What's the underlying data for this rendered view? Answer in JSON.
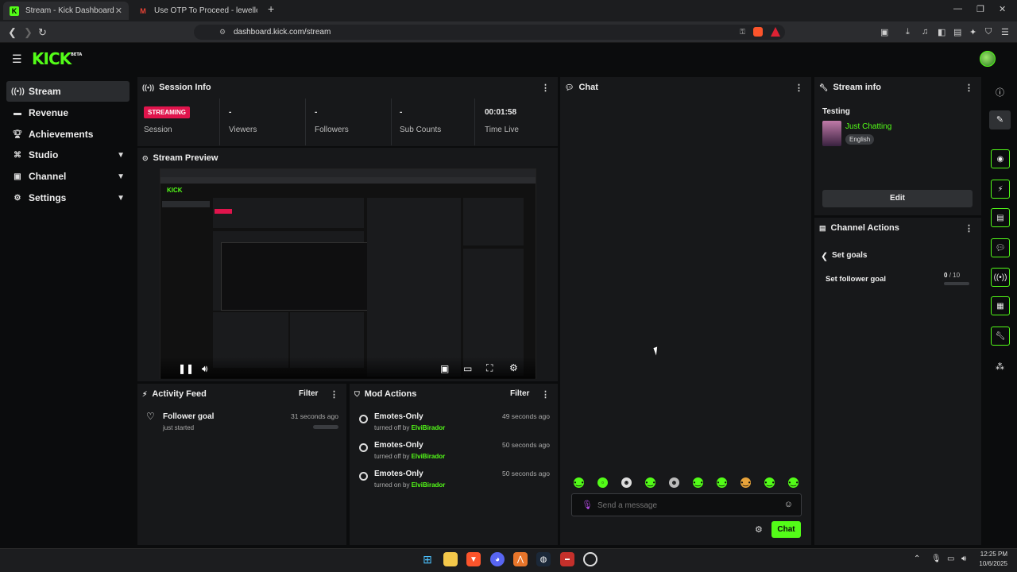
{
  "browser": {
    "tabs": [
      {
        "title": "Stream - Kick Dashboard"
      },
      {
        "title": "Use OTP To Proceed - lewellevillo@g"
      }
    ],
    "url": "dashboard.kick.com/stream"
  },
  "app": {
    "logo": "KICK",
    "logo_badge": "BETA",
    "accent": "#53fc18"
  },
  "sidebar": {
    "items": [
      {
        "label": "Stream",
        "icon": "broadcast-icon"
      },
      {
        "label": "Revenue",
        "icon": "money-icon"
      },
      {
        "label": "Achievements",
        "icon": "trophy-icon"
      },
      {
        "label": "Studio",
        "icon": "studio-icon"
      },
      {
        "label": "Channel",
        "icon": "channel-icon"
      },
      {
        "label": "Settings",
        "icon": "gear-icon"
      }
    ]
  },
  "session": {
    "title": "Session Info",
    "status": "STREAMING",
    "status_label": "Session",
    "stats": [
      {
        "value": "-",
        "label": "Viewers"
      },
      {
        "value": "-",
        "label": "Followers"
      },
      {
        "value": "-",
        "label": "Sub Counts"
      },
      {
        "value": "00:01:58",
        "label": "Time Live"
      }
    ]
  },
  "preview": {
    "title": "Stream Preview"
  },
  "activity": {
    "title": "Activity Feed",
    "filter": "Filter",
    "items": [
      {
        "title": "Follower goal",
        "sub": "just started",
        "time": "31 seconds ago"
      }
    ]
  },
  "mod": {
    "title": "Mod Actions",
    "filter": "Filter",
    "items": [
      {
        "title": "Emotes-Only",
        "action": "turned off by",
        "user": "ElviBirador",
        "time": "49 seconds ago"
      },
      {
        "title": "Emotes-Only",
        "action": "turned off by",
        "user": "ElviBirador",
        "time": "50 seconds ago"
      },
      {
        "title": "Emotes-Only",
        "action": "turned on by",
        "user": "ElviBirador",
        "time": "50 seconds ago"
      }
    ]
  },
  "chat": {
    "title": "Chat",
    "placeholder": "Send a message",
    "send": "Chat"
  },
  "stream_info": {
    "title": "Stream info",
    "stream_title": "Testing",
    "category": "Just Chatting",
    "language": "English",
    "edit": "Edit"
  },
  "channel_actions": {
    "title": "Channel Actions",
    "back": "Set goals",
    "goal_label": "Set follower goal",
    "goal_current": "0",
    "goal_total": "/ 10",
    "goal_progress": 0
  },
  "taskbar": {
    "time": "12:25 PM",
    "date": "10/6/2025"
  }
}
